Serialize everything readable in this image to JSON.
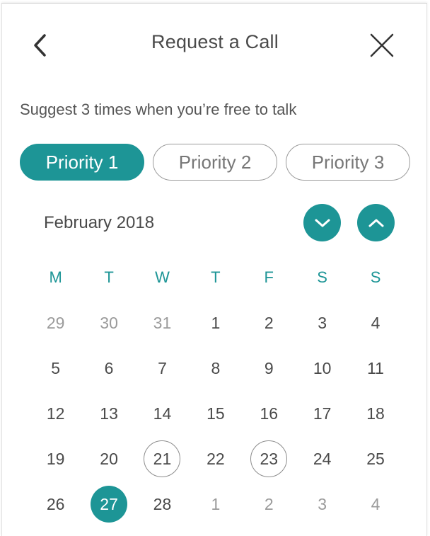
{
  "header": {
    "title": "Request a Call",
    "back_icon": "chevron-left-icon",
    "close_icon": "close-icon"
  },
  "subtitle": "Suggest 3 times when you’re free to talk",
  "priorities": [
    {
      "label": "Priority 1",
      "active": true
    },
    {
      "label": "Priority 2",
      "active": false
    },
    {
      "label": "Priority 3",
      "active": false
    }
  ],
  "calendar": {
    "month": "February 2018",
    "prev_icon": "chevron-down-icon",
    "next_icon": "chevron-up-icon",
    "weekdays": [
      "M",
      "T",
      "W",
      "T",
      "F",
      "S",
      "S"
    ],
    "weeks": [
      [
        {
          "d": "29",
          "muted": true
        },
        {
          "d": "30",
          "muted": true
        },
        {
          "d": "31",
          "muted": true
        },
        {
          "d": "1"
        },
        {
          "d": "2"
        },
        {
          "d": "3"
        },
        {
          "d": "4"
        }
      ],
      [
        {
          "d": "5"
        },
        {
          "d": "6"
        },
        {
          "d": "7"
        },
        {
          "d": "8"
        },
        {
          "d": "9"
        },
        {
          "d": "10"
        },
        {
          "d": "11"
        }
      ],
      [
        {
          "d": "12"
        },
        {
          "d": "13"
        },
        {
          "d": "14"
        },
        {
          "d": "15"
        },
        {
          "d": "16"
        },
        {
          "d": "17"
        },
        {
          "d": "18"
        }
      ],
      [
        {
          "d": "19"
        },
        {
          "d": "20"
        },
        {
          "d": "21",
          "outlined": true
        },
        {
          "d": "22"
        },
        {
          "d": "23",
          "outlined": true
        },
        {
          "d": "24"
        },
        {
          "d": "25"
        }
      ],
      [
        {
          "d": "26"
        },
        {
          "d": "27",
          "selected": true
        },
        {
          "d": "28"
        },
        {
          "d": "1",
          "muted": true
        },
        {
          "d": "2",
          "muted": true
        },
        {
          "d": "3",
          "muted": true
        },
        {
          "d": "4",
          "muted": true
        }
      ]
    ]
  },
  "colors": {
    "accent": "#1d9596",
    "text": "#4a4a4a",
    "muted": "#9b9b9b"
  }
}
